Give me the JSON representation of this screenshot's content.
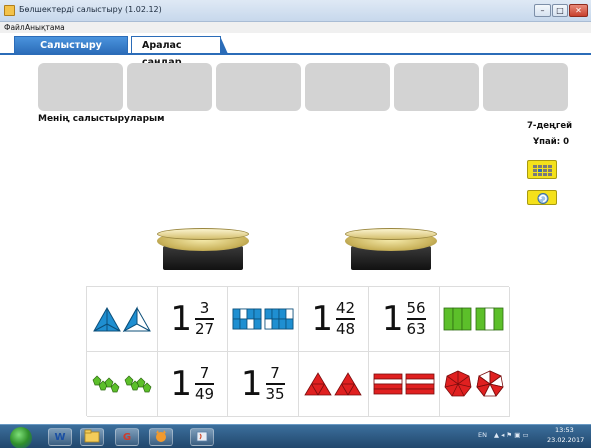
{
  "window": {
    "title": "Бөлшектерді салыстыру (1.02.12)",
    "minimize_glyph": "–",
    "maximize_glyph": "□",
    "close_glyph": "✕"
  },
  "menu": {
    "items": [
      "Файл",
      "Анықтама"
    ]
  },
  "tabs": [
    {
      "label": "Салыстыру ойыны",
      "active": true
    },
    {
      "label": "Аралас сандар",
      "active": false
    }
  ],
  "board": {
    "my_comparisons_label": "Менің салыстыруларым",
    "level": "7-деңгей",
    "score": "Ұпай: 0"
  },
  "cards": [
    {
      "kind": "shape",
      "icon": "triangle-pair-blue-icon"
    },
    {
      "kind": "fraction",
      "whole": "1",
      "numerator": "3",
      "denominator": "27"
    },
    {
      "kind": "shape",
      "icon": "grid-squares-blue-icon"
    },
    {
      "kind": "fraction",
      "whole": "1",
      "numerator": "42",
      "denominator": "48"
    },
    {
      "kind": "fraction",
      "whole": "1",
      "numerator": "56",
      "denominator": "63"
    },
    {
      "kind": "shape",
      "icon": "bars-green-icon"
    },
    {
      "kind": "shape",
      "icon": "pentagons-green-icon"
    },
    {
      "kind": "fraction",
      "whole": "1",
      "numerator": "7",
      "denominator": "49"
    },
    {
      "kind": "fraction",
      "whole": "1",
      "numerator": "7",
      "denominator": "35"
    },
    {
      "kind": "shape",
      "icon": "triangle-pair-red-icon"
    },
    {
      "kind": "shape",
      "icon": "stripes-red-icon"
    },
    {
      "kind": "shape",
      "icon": "heptagon-red-icon"
    }
  ],
  "taskbar": {
    "apps": [
      "W",
      "",
      "G",
      "",
      ""
    ],
    "lang": "EN",
    "time": "13:53",
    "date": "23.02.2017"
  },
  "colors": {
    "tab_active": "#2b6cb8",
    "yellow_button": "#f4e11b",
    "blue_shape": "#1f8fd1",
    "green_shape": "#5cbf2a",
    "red_shape": "#e02020"
  }
}
